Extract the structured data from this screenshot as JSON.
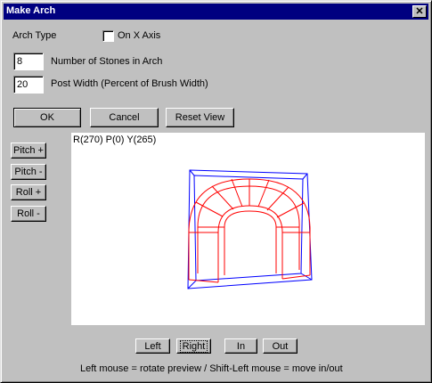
{
  "window": {
    "title": "Make Arch",
    "close_glyph": "✕"
  },
  "arch_type": {
    "label": "Arch Type",
    "checkbox_label": "On X Axis",
    "checked": false
  },
  "stones": {
    "value": "8",
    "label": "Number of Stones in Arch"
  },
  "post_width": {
    "value": "20",
    "label": "Post Width (Percent of Brush Width)"
  },
  "buttons": {
    "ok": "OK",
    "cancel": "Cancel",
    "reset_view": "Reset View"
  },
  "side_buttons": {
    "pitch_plus": "Pitch +",
    "pitch_minus": "Pitch -",
    "roll_plus": "Roll +",
    "roll_minus": "Roll -"
  },
  "preview": {
    "readout": "R(270) P(0) Y(265)",
    "colors": {
      "frame": "#0000ff",
      "arch": "#ff0000"
    }
  },
  "bottom_buttons": {
    "left": "Left",
    "right": "Right",
    "in": "In",
    "out": "Out"
  },
  "hint": "Left mouse = rotate preview  / Shift-Left mouse = move in/out"
}
